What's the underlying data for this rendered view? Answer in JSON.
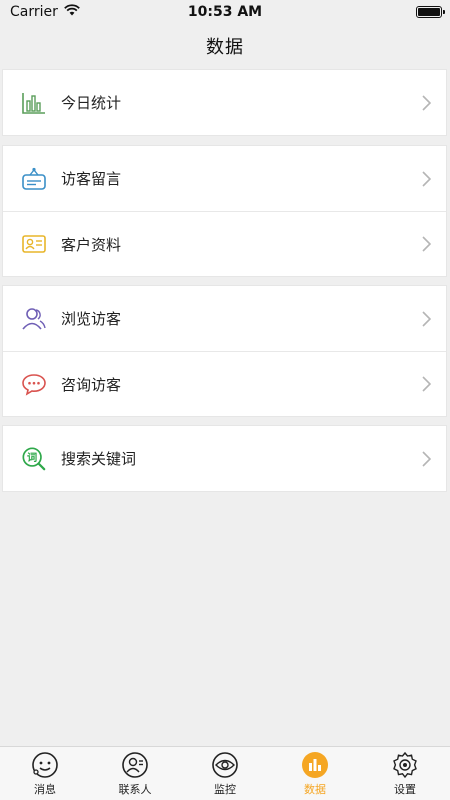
{
  "status_bar": {
    "carrier": "Carrier",
    "time": "10:53 AM"
  },
  "nav": {
    "title": "数据"
  },
  "menu": {
    "groups": [
      {
        "items": [
          {
            "label": "今日统计",
            "icon": "bar-chart-icon",
            "color": "#5a9e5a"
          }
        ]
      },
      {
        "items": [
          {
            "label": "访客留言",
            "icon": "message-board-icon",
            "color": "#3a8fc7"
          },
          {
            "label": "客户资料",
            "icon": "id-card-icon",
            "color": "#e8b52a"
          }
        ]
      },
      {
        "items": [
          {
            "label": "浏览访客",
            "icon": "visitors-icon",
            "color": "#6f5fb5"
          },
          {
            "label": "咨询访客",
            "icon": "chat-bubble-icon",
            "color": "#d9534f"
          }
        ]
      },
      {
        "items": [
          {
            "label": "搜索关键词",
            "icon": "keyword-search-icon",
            "color": "#2ea84a"
          }
        ]
      }
    ]
  },
  "tabs": [
    {
      "label": "消息",
      "icon": "message-face-icon",
      "active": false
    },
    {
      "label": "联系人",
      "icon": "contacts-icon",
      "active": false
    },
    {
      "label": "监控",
      "icon": "eye-icon",
      "active": false
    },
    {
      "label": "数据",
      "icon": "data-bars-icon",
      "active": true
    },
    {
      "label": "设置",
      "icon": "settings-gear-icon",
      "active": false
    }
  ],
  "colors": {
    "accent": "#f5a623",
    "background": "#efefef"
  }
}
